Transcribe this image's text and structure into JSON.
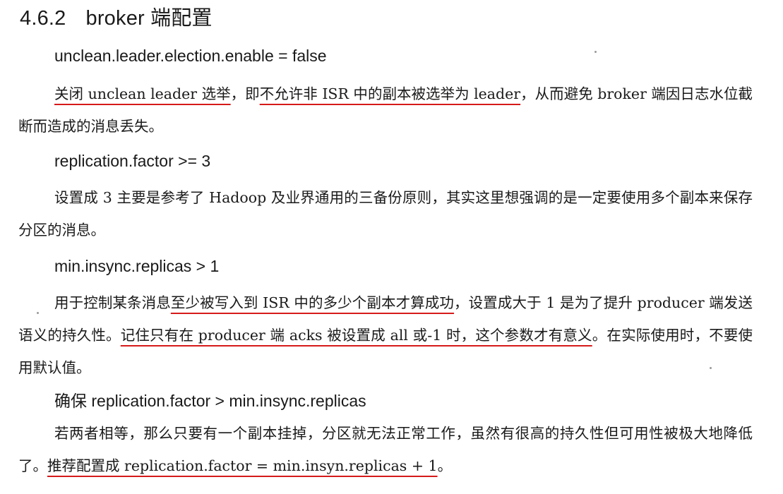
{
  "heading": {
    "number": "4.6.2",
    "title": "broker 端配置"
  },
  "sections": [
    {
      "config": "unclean.leader.election.enable = false",
      "paragraph": [
        {
          "text": "关闭 unclean leader 选举",
          "underline": true
        },
        {
          "text": "，即",
          "underline": false
        },
        {
          "text": "不允许非 ISR 中的副本被选举为 leader",
          "underline": true
        },
        {
          "text": "，从而避免 broker 端因日志水位截断而造成的消息丢失。",
          "underline": false
        }
      ]
    },
    {
      "config": "replication.factor >= 3",
      "paragraph": [
        {
          "text": "设置成 3 主要是参考了 Hadoop 及业界通用的三备份原则，其实这里想强调的是一定要使用多个副本来保存分区的消息。",
          "underline": false
        }
      ]
    },
    {
      "config": "min.insync.replicas > 1",
      "paragraph": [
        {
          "text": "用于控制某条消息",
          "underline": false
        },
        {
          "text": "至少被写入到 ISR 中的多少个副本才算成功",
          "underline": true
        },
        {
          "text": "，设置成大于 1 是为了提升 producer 端发送语义的持久性。",
          "underline": false
        },
        {
          "text": "记住只有在 producer 端 acks 被设置成 all 或-1 时，这个参数才有意义",
          "underline": true
        },
        {
          "text": "。在实际使用时，不要使用默认值。",
          "underline": false
        }
      ]
    },
    {
      "config": "确保 replication.factor > min.insync.replicas",
      "paragraph": [
        {
          "text": "若两者相等，那么只要有一个副本挂掉，分区就无法正常工作，虽然有很高的持久性但可用性被极大地降低了。",
          "underline": false
        },
        {
          "text": "推荐配置成 replication.factor = min.insyn.replicas + 1",
          "underline": true
        },
        {
          "text": "。",
          "underline": false
        }
      ]
    }
  ],
  "colors": {
    "underline": "#d61a1a",
    "text": "#1a1a1a"
  }
}
